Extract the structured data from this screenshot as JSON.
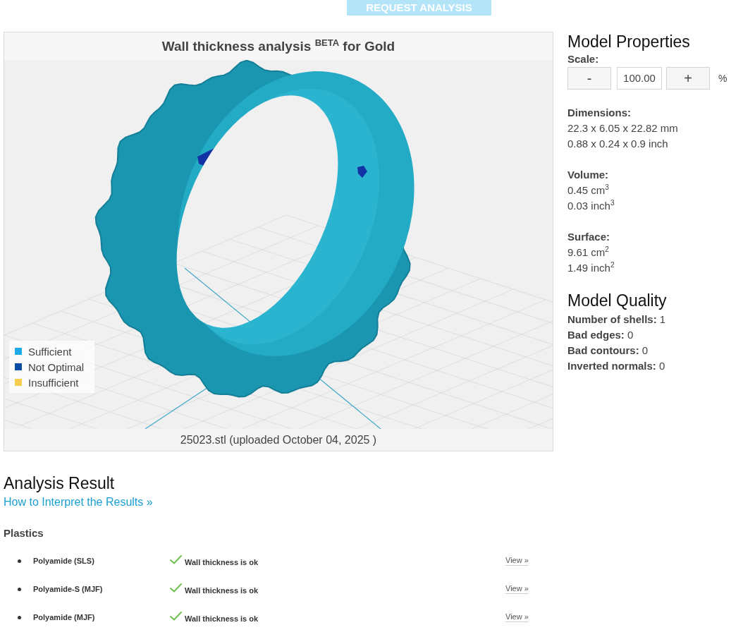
{
  "request_button": {
    "label": "REQUEST ANALYSIS",
    "disabled": true
  },
  "viewer": {
    "title": "Wall thickness analysis $^{BETA}$ for Gold",
    "legend": [
      {
        "label": "Sufficient",
        "color": "#1ca9e6"
      },
      {
        "label": "Not Optimal",
        "color": "#0b4da2"
      },
      {
        "label": "Insufficient",
        "color": "#f6cd4f"
      }
    ],
    "caption": "25023.stl (uploaded October 04, 2025 )"
  },
  "model_properties": {
    "title": "Model Properties",
    "scale": {
      "label": "Scale:",
      "decrease": "-",
      "value": "100.00",
      "increase": "+",
      "unit": "%"
    },
    "groups": [
      {
        "label": "Dimensions:",
        "lines": [
          "22.3 x 6.05 x 22.82 mm",
          "0.88 x 0.24 x 0.9 inch"
        ]
      },
      {
        "label": "Volume:",
        "lines": [
          "0.45 cm$^{3}$",
          "0.03 inch$^{3}$"
        ]
      },
      {
        "label": "Surface:",
        "lines": [
          "9.61 cm$^{2}$",
          "1.49 inch$^{2}$"
        ]
      }
    ]
  },
  "model_quality": {
    "title": "Model Quality",
    "items": [
      {
        "label": "Number of shells:",
        "value": "1"
      },
      {
        "label": "Bad edges:",
        "value": "0"
      },
      {
        "label": "Bad contours:",
        "value": "0"
      },
      {
        "label": "Inverted normals:",
        "value": "0"
      }
    ]
  },
  "analysis_result": {
    "title": "Analysis Result",
    "link": "How to Interpret the Results »",
    "sections": [
      {
        "heading": "Plastics",
        "materials": [
          {
            "name": "Polyamide (SLS)",
            "ok": true,
            "status": "Wall thickness is ok",
            "action": "View »"
          },
          {
            "name": "Polyamide-S (MJF)",
            "ok": true,
            "status": "Wall thickness is ok",
            "action": "View »"
          },
          {
            "name": "Polyamide (MJF)",
            "ok": true,
            "status": "Wall thickness is ok",
            "action": "View »"
          }
        ]
      }
    ]
  }
}
